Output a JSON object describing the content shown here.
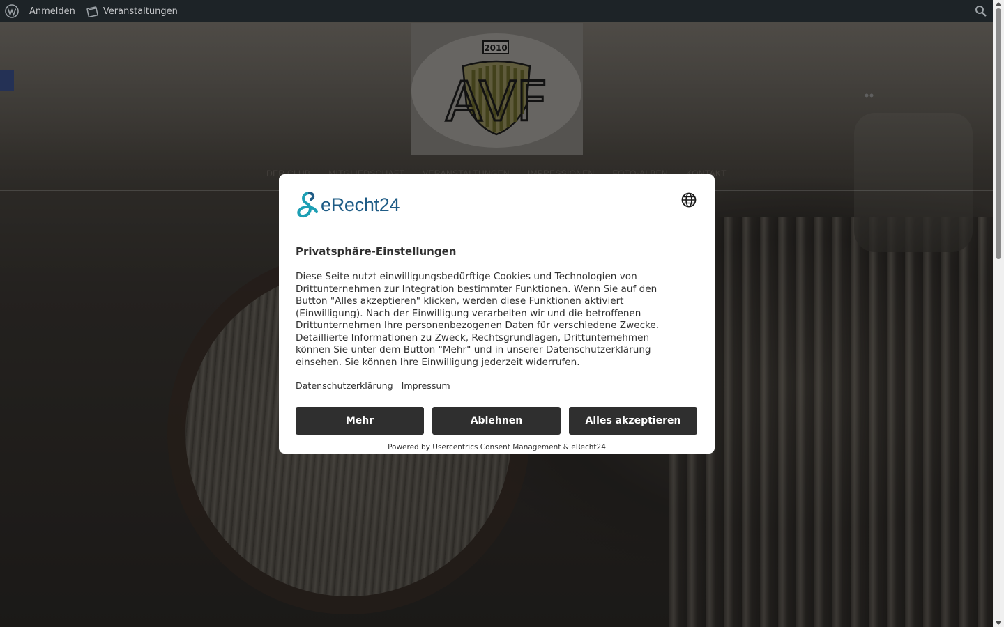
{
  "adminbar": {
    "login_label": "Anmelden",
    "events_label": "Veranstaltungen"
  },
  "site": {
    "logo_year": "2010",
    "logo_letters": "AVF",
    "nav": [
      "DER CLUB",
      "MITGLIEDSCHAFT",
      "VERANSTALTUNGEN",
      "IMPRESSIONEN",
      "FOTO-ALBEN",
      "KONTAKT"
    ]
  },
  "consent": {
    "brand": "eRecht24",
    "title": "Privatsphäre-Einstellungen",
    "body": "Diese Seite nutzt einwilligungsbedürftige Cookies und Technologien von Drittunternehmen zur Integration bestimmter Funktionen. Wenn Sie auf den Button \"Alles akzeptieren\" klicken, werden diese Funktionen aktiviert (Einwilligung). Nach der Einwilligung verarbeiten wir und die betroffenen Drittunternehmen Ihre personenbezogenen Daten für verschiedene Zwecke. Detaillierte Informationen zu Zweck, Rechtsgrundlagen, Drittunternehmen können Sie unter dem Button \"Mehr\" und in unserer Datenschutzerklärung einsehen. Sie können Ihre Einwilligung jederzeit widerrufen.",
    "link_privacy": "Datenschutzerklärung",
    "link_imprint": "Impressum",
    "btn_more": "Mehr",
    "btn_decline": "Ablehnen",
    "btn_accept": "Alles akzeptieren",
    "powered_by": "Powered by Usercentrics Consent Management & eRecht24"
  },
  "colors": {
    "admin_bar": "#1d2327",
    "button": "#2f2f2f",
    "brand": "#1f5c86"
  }
}
